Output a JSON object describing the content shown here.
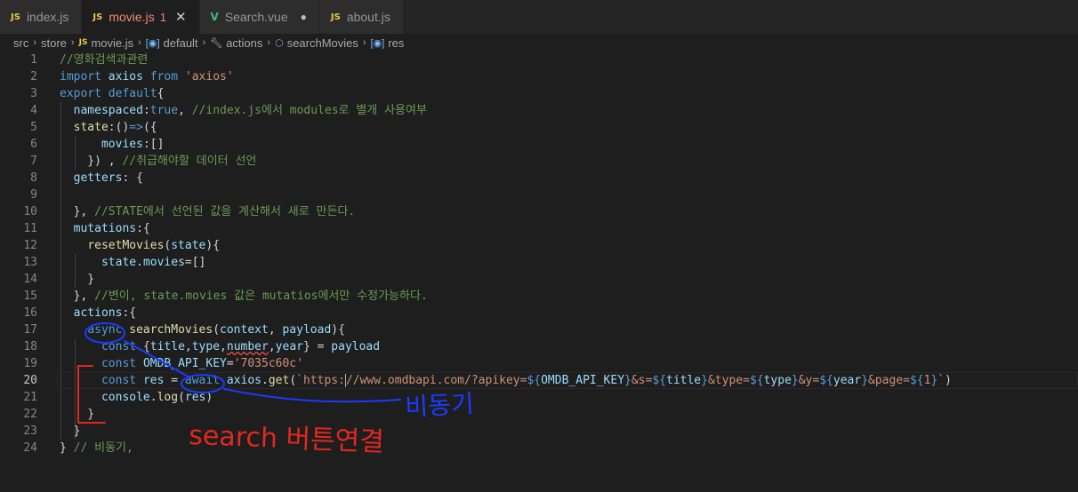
{
  "tabs": [
    {
      "icon": "JS",
      "name": "index.js",
      "active": false
    },
    {
      "icon": "JS",
      "name": "movie.js",
      "active": true,
      "problems": "1",
      "close": "✕"
    },
    {
      "icon": "V",
      "name": "Search.vue",
      "active": false,
      "dot": "●"
    },
    {
      "icon": "JS",
      "name": "about.js",
      "active": false
    }
  ],
  "breadcrumb": {
    "src": "src",
    "store": "store",
    "file_icon": "JS",
    "file": "movie.js",
    "default": "default",
    "actions": "actions",
    "searchMovies": "searchMovies",
    "res": "res",
    "sep": "›"
  },
  "editor": {
    "current_line": 20,
    "lines": [
      {
        "n": "1",
        "tokens": [
          [
            "c",
            "//영화검색과관련"
          ]
        ]
      },
      {
        "n": "2",
        "tokens": [
          [
            "k",
            "import "
          ],
          [
            "v",
            "axios "
          ],
          [
            "k",
            "from "
          ],
          [
            "s",
            "'axios'"
          ]
        ]
      },
      {
        "n": "3",
        "tokens": [
          [
            "k",
            "export default"
          ],
          [
            "p",
            "{"
          ]
        ]
      },
      {
        "n": "4",
        "tokens": [
          [
            "p",
            "  "
          ],
          [
            "v",
            "namespaced"
          ],
          [
            "p",
            ":"
          ],
          [
            "k",
            "true"
          ],
          [
            "p",
            ", "
          ],
          [
            "c",
            "//index.js에서 modules로 별개 사용여부"
          ]
        ]
      },
      {
        "n": "5",
        "tokens": [
          [
            "p",
            "  "
          ],
          [
            "f",
            "state"
          ],
          [
            "p",
            ":()"
          ],
          [
            "k",
            "=>"
          ],
          [
            "p",
            "({"
          ]
        ]
      },
      {
        "n": "6",
        "tokens": [
          [
            "p",
            "      "
          ],
          [
            "v",
            "movies"
          ],
          [
            "p",
            ":[]"
          ]
        ]
      },
      {
        "n": "7",
        "tokens": [
          [
            "p",
            "    }) , "
          ],
          [
            "c",
            "//취급해야할 데이터 선언"
          ]
        ]
      },
      {
        "n": "8",
        "tokens": [
          [
            "p",
            "  "
          ],
          [
            "v",
            "getters"
          ],
          [
            "p",
            ": {"
          ]
        ]
      },
      {
        "n": "9",
        "tokens": [
          [
            "p",
            ""
          ]
        ]
      },
      {
        "n": "10",
        "tokens": [
          [
            "p",
            "  }, "
          ],
          [
            "c",
            "//STATE에서 선언된 값을 계산해서 새로 만든다."
          ]
        ]
      },
      {
        "n": "11",
        "tokens": [
          [
            "p",
            "  "
          ],
          [
            "v",
            "mutations"
          ],
          [
            "p",
            ":{"
          ]
        ]
      },
      {
        "n": "12",
        "tokens": [
          [
            "p",
            "    "
          ],
          [
            "f",
            "resetMovies"
          ],
          [
            "p",
            "("
          ],
          [
            "v",
            "state"
          ],
          [
            "p",
            "){"
          ]
        ]
      },
      {
        "n": "13",
        "tokens": [
          [
            "p",
            "      "
          ],
          [
            "v",
            "state"
          ],
          [
            "p",
            "."
          ],
          [
            "v",
            "movies"
          ],
          [
            "p",
            "=[]"
          ]
        ]
      },
      {
        "n": "14",
        "tokens": [
          [
            "p",
            "    }"
          ]
        ]
      },
      {
        "n": "15",
        "tokens": [
          [
            "p",
            "  }, "
          ],
          [
            "c",
            "//변이, state.movies 값은 mutatios에서만 수정가능하다."
          ]
        ]
      },
      {
        "n": "16",
        "tokens": [
          [
            "p",
            "  "
          ],
          [
            "v",
            "actions"
          ],
          [
            "p",
            ":{"
          ]
        ]
      },
      {
        "n": "17",
        "tokens": [
          [
            "p",
            "    "
          ],
          [
            "k",
            "async "
          ],
          [
            "f",
            "searchMovies"
          ],
          [
            "p",
            "("
          ],
          [
            "v",
            "context"
          ],
          [
            "p",
            ", "
          ],
          [
            "v",
            "payload"
          ],
          [
            "p",
            "){"
          ]
        ]
      },
      {
        "n": "18",
        "tokens": [
          [
            "p",
            "      "
          ],
          [
            "k",
            "const "
          ],
          [
            "p",
            "{"
          ],
          [
            "v",
            "title"
          ],
          [
            "p",
            ","
          ],
          [
            "v",
            "type"
          ],
          [
            "p",
            ","
          ],
          [
            "verr",
            "number"
          ],
          [
            "p",
            ","
          ],
          [
            "v",
            "year"
          ],
          [
            "p",
            "} = "
          ],
          [
            "v",
            "payload"
          ]
        ]
      },
      {
        "n": "19",
        "tokens": [
          [
            "p",
            "      "
          ],
          [
            "k",
            "const "
          ],
          [
            "v",
            "OMDB_API_KEY"
          ],
          [
            "p",
            "="
          ],
          [
            "s",
            "'7035c60c'"
          ]
        ]
      },
      {
        "n": "20",
        "tokens": [
          [
            "p",
            "      "
          ],
          [
            "k",
            "const "
          ],
          [
            "v",
            "res"
          ],
          [
            "p",
            " = "
          ],
          [
            "k",
            "await "
          ],
          [
            "v",
            "axios"
          ],
          [
            "p",
            "."
          ],
          [
            "f",
            "get"
          ],
          [
            "p",
            "("
          ],
          [
            "s",
            "`https:"
          ],
          [
            "cur",
            ""
          ],
          [
            "s",
            "//www.omdbapi.com/?apikey="
          ],
          [
            "k",
            "${"
          ],
          [
            "v",
            "OMDB_API_KEY"
          ],
          [
            "k",
            "}"
          ],
          [
            "s",
            "&s="
          ],
          [
            "k",
            "${"
          ],
          [
            "v",
            "title"
          ],
          [
            "k",
            "}"
          ],
          [
            "s",
            "&type="
          ],
          [
            "k",
            "${"
          ],
          [
            "v",
            "type"
          ],
          [
            "k",
            "}"
          ],
          [
            "s",
            "&y="
          ],
          [
            "k",
            "${"
          ],
          [
            "v",
            "year"
          ],
          [
            "k",
            "}"
          ],
          [
            "s",
            "&page="
          ],
          [
            "k",
            "${"
          ],
          [
            "s",
            "1"
          ],
          [
            "k",
            "}"
          ],
          [
            "s",
            "`"
          ],
          [
            "p",
            ")"
          ]
        ]
      },
      {
        "n": "21",
        "tokens": [
          [
            "p",
            "      "
          ],
          [
            "v",
            "console"
          ],
          [
            "p",
            "."
          ],
          [
            "f",
            "log"
          ],
          [
            "p",
            "("
          ],
          [
            "v",
            "res"
          ],
          [
            "p",
            ")"
          ]
        ]
      },
      {
        "n": "22",
        "tokens": [
          [
            "p",
            "    }"
          ]
        ]
      },
      {
        "n": "23",
        "tokens": [
          [
            "p",
            "  }"
          ]
        ]
      },
      {
        "n": "24",
        "tokens": [
          [
            "p",
            "} "
          ],
          [
            "c",
            "// 비동기,"
          ]
        ]
      }
    ]
  },
  "annotations": {
    "red_text": "search 버튼연결",
    "blue_text": "비동기",
    "red_color": "#e0281f",
    "blue_color": "#1a3cff"
  },
  "colors": {
    "keyword": "#569cd6",
    "comment": "#6a9955",
    "string": "#ce9178",
    "function": "#dcdcaa",
    "variable": "#9cdcfe"
  }
}
